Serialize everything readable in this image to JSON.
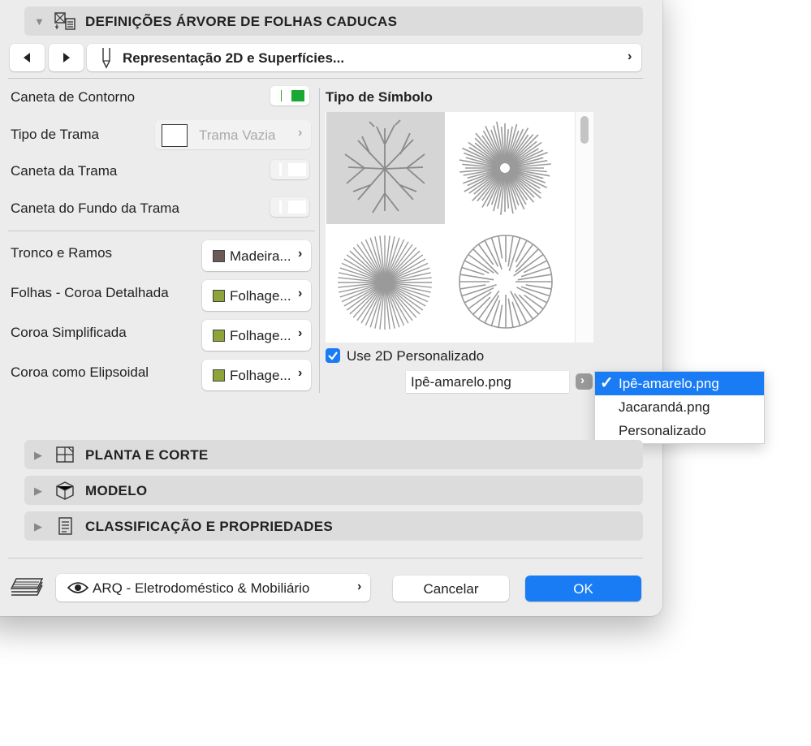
{
  "header": {
    "title": "DEFINIÇÕES ÁRVORE DE FOLHAS CADUCAS"
  },
  "nav": {
    "panel_label": "Representação 2D e Superfícies..."
  },
  "left": {
    "pen_rows": [
      {
        "label": "Caneta de Contorno",
        "color": "#1aa832"
      },
      {
        "label": "Tipo de Trama",
        "value": "Trama Vazia"
      },
      {
        "label": "Caneta da Trama"
      },
      {
        "label": "Caneta do Fundo da Trama"
      }
    ],
    "surfaces": [
      {
        "label": "Tronco e Ramos",
        "value": "Madeira...",
        "color": "#6b5a55"
      },
      {
        "label": "Folhas - Coroa Detalhada",
        "value": "Folhage...",
        "color": "#8ea33a"
      },
      {
        "label": "Coroa Simplificada",
        "value": "Folhage...",
        "color": "#8ea33a"
      },
      {
        "label": "Coroa como Elipsoidal",
        "value": "Folhage...",
        "color": "#8ea33a"
      }
    ]
  },
  "symbol": {
    "title": "Tipo de Símbolo",
    "custom_2d_label": "Use 2D Personalizado",
    "custom_2d_checked": true,
    "file_value": "Ipê-amarelo.png"
  },
  "dropdown": {
    "options": [
      "Ipê-amarelo.png",
      "Jacarandá.png",
      "Personalizado"
    ],
    "selected": "Ipê-amarelo.png",
    "check": "✓"
  },
  "sections": [
    {
      "title": "PLANTA E CORTE"
    },
    {
      "title": "MODELO"
    },
    {
      "title": "CLASSIFICAÇÃO E PROPRIEDADES"
    }
  ],
  "footer": {
    "layer_label": "ARQ - Eletrodoméstico & Mobiliário",
    "cancel_label": "Cancelar",
    "ok_label": "OK"
  },
  "colors": {
    "accent": "#1a7cf5",
    "bar": "#dcdcdc",
    "dialog": "#ececec"
  }
}
